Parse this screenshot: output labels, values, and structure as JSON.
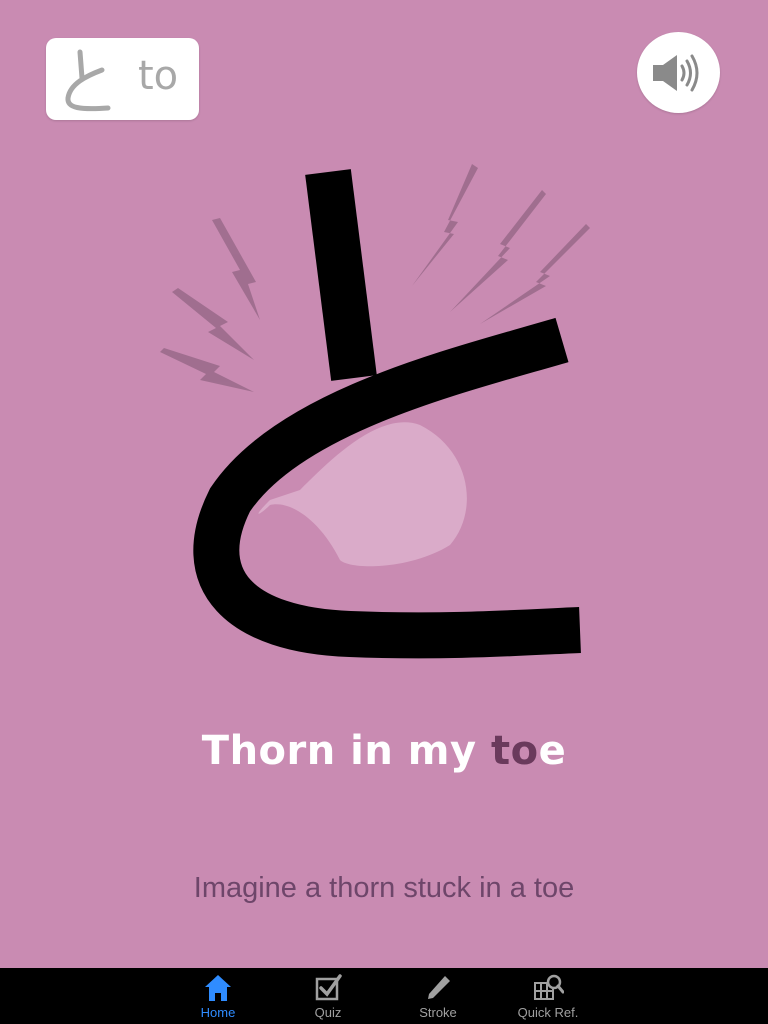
{
  "header": {
    "kana": "と",
    "romaji": "to"
  },
  "mnemonic": {
    "before": "Thorn in my ",
    "highlight": "to",
    "after": "e"
  },
  "description": "Imagine a thorn stuck in a toe",
  "icons": {
    "sound": "speaker-icon",
    "home": "home-icon",
    "quiz": "checkbox-icon",
    "stroke": "pencil-icon",
    "quickref": "grid-search-icon"
  },
  "colors": {
    "background": "#c98bb2",
    "highlight": "#6a3a5c",
    "active_tab": "#2f8cff"
  },
  "tabs": [
    {
      "label": "Home",
      "active": true
    },
    {
      "label": "Quiz",
      "active": false
    },
    {
      "label": "Stroke",
      "active": false
    },
    {
      "label": "Quick Ref.",
      "active": false
    }
  ]
}
